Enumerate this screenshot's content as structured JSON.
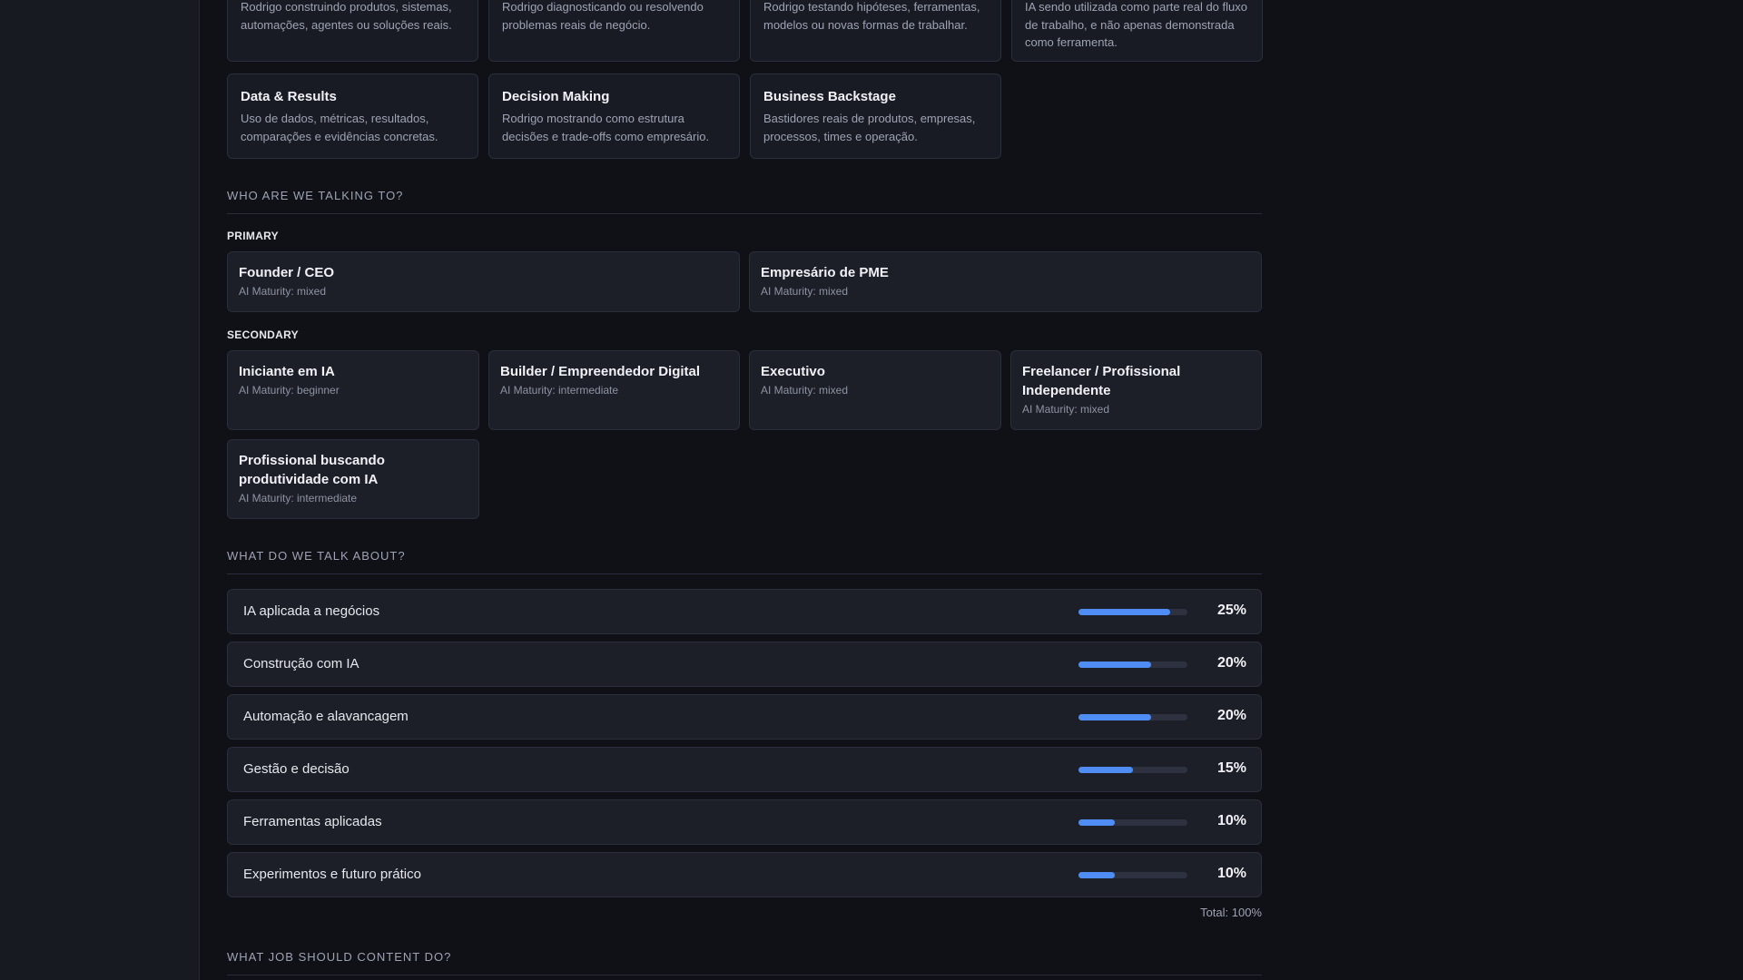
{
  "pillars_partial": [
    {
      "desc": "Rodrigo construindo produtos, sistemas, automações, agentes ou soluções reais."
    },
    {
      "desc": "Rodrigo diagnosticando ou resolvendo problemas reais de negócio."
    },
    {
      "desc": "Rodrigo testando hipóteses, ferramentas, modelos ou novas formas de trabalhar."
    },
    {
      "desc": "IA sendo utilizada como parte real do fluxo de trabalho, e não apenas demonstrada como ferramenta."
    }
  ],
  "pillars": [
    {
      "title": "Data & Results",
      "desc": "Uso de dados, métricas, resultados, comparações e evidências concretas."
    },
    {
      "title": "Decision Making",
      "desc": "Rodrigo mostrando como estrutura decisões e trade-offs como empresário."
    },
    {
      "title": "Business Backstage",
      "desc": "Bastidores reais de produtos, empresas, processos, times e operação."
    }
  ],
  "audience": {
    "section_title": "WHO ARE WE TALKING TO?",
    "primary_label": "PRIMARY",
    "secondary_label": "SECONDARY",
    "primary": [
      {
        "name": "Founder / CEO",
        "maturity": "AI Maturity: mixed"
      },
      {
        "name": "Empresário de PME",
        "maturity": "AI Maturity: mixed"
      }
    ],
    "secondary": [
      {
        "name": "Iniciante em IA",
        "maturity": "AI Maturity: beginner"
      },
      {
        "name": "Builder / Empreendedor Digital",
        "maturity": "AI Maturity: intermediate"
      },
      {
        "name": "Executivo",
        "maturity": "AI Maturity: mixed"
      },
      {
        "name": "Freelancer / Profissional Independente",
        "maturity": "AI Maturity: mixed"
      },
      {
        "name": "Profissional buscando produtividade com IA",
        "maturity": "AI Maturity: intermediate"
      }
    ]
  },
  "topics": {
    "section_title": "WHAT DO WE TALK ABOUT?",
    "items": [
      {
        "label": "IA aplicada a negócios",
        "pct": "25%",
        "fill": 0.84
      },
      {
        "label": "Construção com IA",
        "pct": "20%",
        "fill": 0.67
      },
      {
        "label": "Automação e alavancagem",
        "pct": "20%",
        "fill": 0.67
      },
      {
        "label": "Gestão e decisão",
        "pct": "15%",
        "fill": 0.5
      },
      {
        "label": "Ferramentas aplicadas",
        "pct": "10%",
        "fill": 0.33
      },
      {
        "label": "Experimentos e futuro prático",
        "pct": "10%",
        "fill": 0.33
      }
    ],
    "total": "Total: 100%"
  },
  "jobs": {
    "section_title": "WHAT JOB SHOULD CONTENT DO?"
  },
  "colors": {
    "accent": "#4f8df5",
    "background": "#101117",
    "card": "#191b24"
  }
}
